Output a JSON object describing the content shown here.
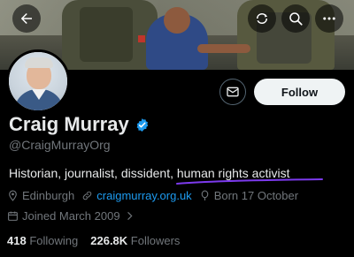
{
  "header": {
    "back_icon": "arrow-left-icon",
    "repost_icon": "repost-icon",
    "search_icon": "search-icon",
    "more_icon": "more-icon"
  },
  "profile": {
    "name": "Craig Murray",
    "handle": "@CraigMurrayOrg",
    "verified": true,
    "bio": "Historian, journalist, dissident, human rights activist",
    "location": "Edinburgh",
    "website": "craigmurray.org.uk",
    "birthday": "Born 17 October",
    "joined": "Joined March 2009",
    "following_count": "418",
    "following_label": "Following",
    "followers_count": "226.8K",
    "followers_label": "Followers"
  },
  "actions": {
    "message_icon": "mail-icon",
    "follow_label": "Follow"
  },
  "colors": {
    "accent": "#1d9bf0",
    "underline": "#7c3aed"
  }
}
